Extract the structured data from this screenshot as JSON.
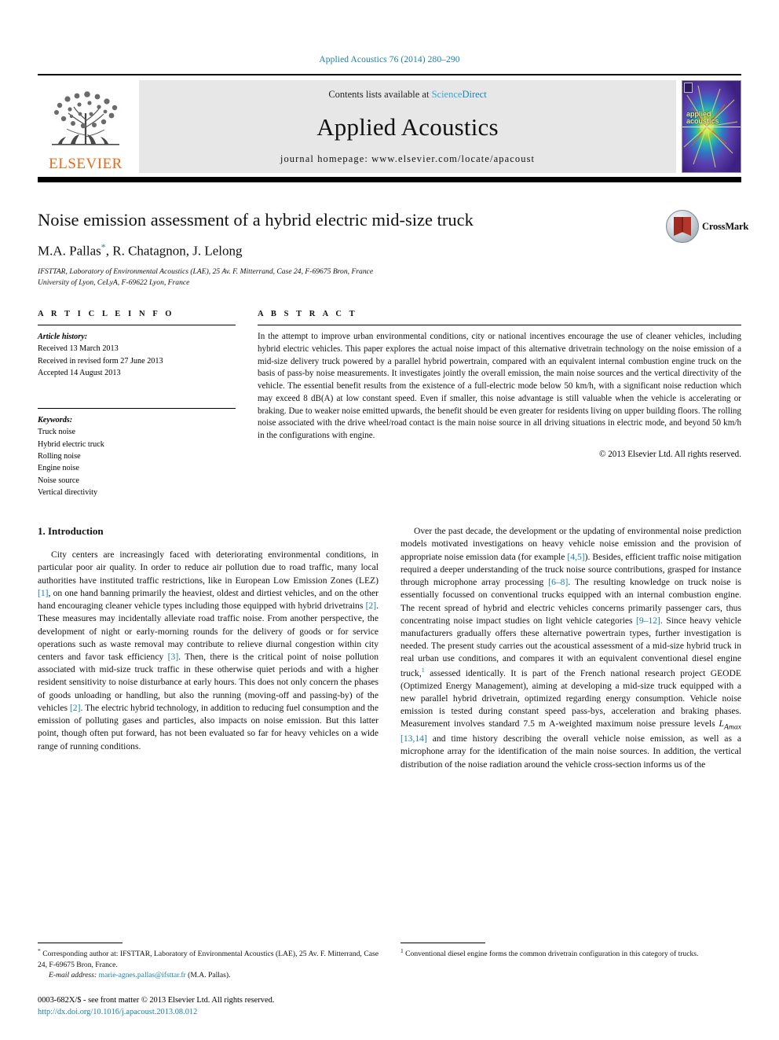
{
  "running_head": "Applied Acoustics 76 (2014) 280–290",
  "masthead": {
    "publisher": "ELSEVIER",
    "contents_prefix": "Contents lists available at ",
    "contents_link_science": "Science",
    "contents_link_direct": "Direct",
    "journal_name": "Applied Acoustics",
    "homepage": "journal homepage: www.elsevier.com/locate/apacoust",
    "cover_tag_line1": "applied",
    "cover_tag_line2": "acoustics"
  },
  "article": {
    "title": "Noise emission assessment of a hybrid electric mid-size truck",
    "authors": "M.A. Pallas",
    "authors_rest": ", R. Chatagnon, J. Lelong",
    "corresponding_star": "*",
    "affiliation_1": "IFSTTAR, Laboratory of Environmental Acoustics (LAE), 25 Av. F. Mitterrand, Case 24, F-69675 Bron, France",
    "affiliation_2": "University of Lyon, CeLyA, F-69622 Lyon, France",
    "crossmark_label": "CrossMark"
  },
  "article_info": {
    "heading": "A R T I C L E   I N F O",
    "history_label": "Article history:",
    "history": [
      "Received 13 March 2013",
      "Received in revised form 27 June 2013",
      "Accepted 14 August 2013"
    ],
    "keywords_label": "Keywords:",
    "keywords": [
      "Truck noise",
      "Hybrid electric truck",
      "Rolling noise",
      "Engine noise",
      "Noise source",
      "Vertical directivity"
    ]
  },
  "abstract": {
    "heading": "A B S T R A C T",
    "text": "In the attempt to improve urban environmental conditions, city or national incentives encourage the use of cleaner vehicles, including hybrid electric vehicles. This paper explores the actual noise impact of this alternative drivetrain technology on the noise emission of a mid-size delivery truck powered by a parallel hybrid powertrain, compared with an equivalent internal combustion engine truck on the basis of pass-by noise measurements. It investigates jointly the overall emission, the main noise sources and the vertical directivity of the vehicle. The essential benefit results from the existence of a full-electric mode below 50 km/h, with a significant noise reduction which may exceed 8 dB(A) at low constant speed. Even if smaller, this noise advantage is still valuable when the vehicle is accelerating or braking. Due to weaker noise emitted upwards, the benefit should be even greater for residents living on upper building floors. The rolling noise associated with the drive wheel/road contact is the main noise source in all driving situations in electric mode, and beyond 50 km/h in the configurations with engine.",
    "copyright": "© 2013 Elsevier Ltd. All rights reserved."
  },
  "body": {
    "section_heading": "1. Introduction",
    "left_paragraph_1_a": "City centers are increasingly faced with deteriorating environmental conditions, in particular poor air quality. In order to reduce air pollution due to road traffic, many local authorities have instituted traffic restrictions, like in European Low Emission Zones (LEZ) ",
    "ref_1": "[1]",
    "left_paragraph_1_b": ", on one hand banning primarily the heaviest, oldest and dirtiest vehicles, and on the other hand encouraging cleaner vehicle types including those equipped with hybrid drivetrains ",
    "ref_2": "[2]",
    "left_paragraph_1_c": ". These measures may incidentally alleviate road traffic noise. From another perspective, the development of night or early-morning rounds for the delivery of goods or for service operations such as waste removal may contribute to relieve diurnal congestion within city centers and favor task efficiency ",
    "ref_3": "[3]",
    "left_paragraph_1_d": ". Then, there is the critical point of noise pollution associated with mid-size truck traffic in these otherwise quiet periods and with a higher resident sensitivity to noise disturbance at early hours. This does not only concern the phases of goods unloading or handling, but also the running (moving-off and passing-by) of the vehicles ",
    "ref_2b": "[2]",
    "left_paragraph_1_e": ". The electric hybrid technology, in addition to reducing fuel consumption and the emission of polluting gases and particles, also impacts on noise emission. But this latter point, though often put forward, has not been evaluated so far for heavy vehicles on a wide range of running conditions.",
    "right_paragraph_a": "Over the past decade, the development or the updating of environmental noise prediction models motivated investigations on heavy vehicle noise emission and the provision of appropriate noise emission data (for example ",
    "ref_45": "[4,5]",
    "right_paragraph_b": "). Besides, efficient traffic noise mitigation required a deeper understanding of the truck noise source contributions, grasped for instance through microphone array processing ",
    "ref_68": "[6–8]",
    "right_paragraph_c": ". The resulting knowledge on truck noise is essentially focussed on conventional trucks equipped with an internal combustion engine. The recent spread of hybrid and electric vehicles concerns primarily passenger cars, thus concentrating noise impact studies on light vehicle categories ",
    "ref_912": "[9–12]",
    "right_paragraph_d": ". Since heavy vehicle manufacturers gradually offers these alternative powertrain types, further investigation is needed. The present study carries out the acoustical assessment of a mid-size hybrid truck in real urban use conditions, and compares it with an equivalent conventional diesel engine truck,",
    "footnote_marker": "1",
    "right_paragraph_e": " assessed identically. It is part of the French national research project GEODE (Optimized Energy Management), aiming at developing a mid-size truck equipped with a new parallel hybrid drivetrain, optimized regarding energy consumption. Vehicle noise emission is tested during constant speed pass-bys, acceleration and braking phases. Measurement involves standard 7.5 m A-weighted maximum noise pressure levels ",
    "lamax": "L",
    "lamax_sub": "Amax",
    "ref_1314": "[13,14]",
    "right_paragraph_f": " and time history describing the overall vehicle noise emission, as well as a microphone array for the identification of the main noise sources. In addition, the vertical distribution of the noise radiation around the vehicle cross-section informs us of the"
  },
  "footnotes": {
    "corresponding_mark": "*",
    "corresponding_text": " Corresponding author at: IFSTTAR, Laboratory of Environmental Acoustics (LAE), 25 Av. F. Mitterrand, Case 24, F-69675 Bron, France.",
    "email_label": "E-mail address:",
    "email": "marie-agnes.pallas@ifsttar.fr",
    "email_suffix": " (M.A. Pallas).",
    "right_mark": "1",
    "right_text": " Conventional diesel engine forms the common drivetrain configuration in this category of trucks.",
    "issn_line": "0003-682X/$ - see front matter © 2013 Elsevier Ltd. All rights reserved.",
    "doi_line": "http://dx.doi.org/10.1016/j.apacoust.2013.08.012"
  },
  "colors": {
    "link_blue": "#1a7eab",
    "elsevier_orange": "#e56a17",
    "masthead_gray": "#e7e7e7"
  }
}
